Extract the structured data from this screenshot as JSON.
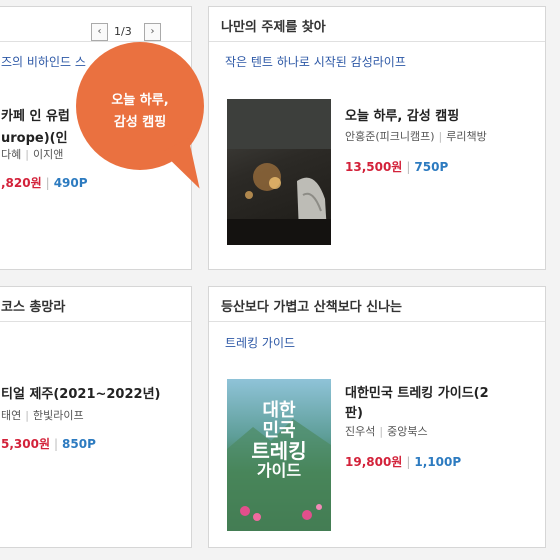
{
  "top_left": {
    "pager": {
      "prev_icon": "‹",
      "next_icon": "›",
      "count": "1/3"
    },
    "subtitle": "즈의 비하인드 스",
    "book": {
      "title_line1": "카페 인 유럽",
      "title_line2": "urope)(인",
      "author": "다혜",
      "publisher": "이지앤",
      "price": ",820원",
      "points": "490P"
    }
  },
  "promo_bubble": {
    "text": "오늘 하루,\n감성 캠핑",
    "color": "#ea7140"
  },
  "top_right": {
    "title": "나만의 주제를 찾아",
    "subtitle": "작은 텐트 하나로 시작된 감성라이프",
    "book": {
      "title": "오늘 하루, 감성 캠핑",
      "author": "안홍준(피크니캠프)",
      "publisher": "루리책방",
      "price": "13,500원",
      "points": "750P"
    }
  },
  "bottom_left": {
    "title": "코스 총망라",
    "book": {
      "title": "티얼 제주(2021~2022년)",
      "author": "태연",
      "publisher": "한빛라이프",
      "price": "5,300원",
      "points": "850P"
    }
  },
  "bottom_right": {
    "title": "등산보다 가볍고 산책보다 신나는",
    "subtitle": "트레킹 가이드",
    "book": {
      "title_line1": "대한민국 트레킹 가이드(2",
      "title_line2": "판)",
      "author": "진우석",
      "publisher": "중앙북스",
      "price": "19,800원",
      "points": "1,100P",
      "cover_text": {
        "line1": "대한",
        "line2": "민국",
        "line3": "트레킹",
        "line4": "가이드"
      }
    }
  },
  "colors": {
    "price": "#d3223a",
    "points": "#2d7bc0",
    "link": "#2d58a6"
  }
}
